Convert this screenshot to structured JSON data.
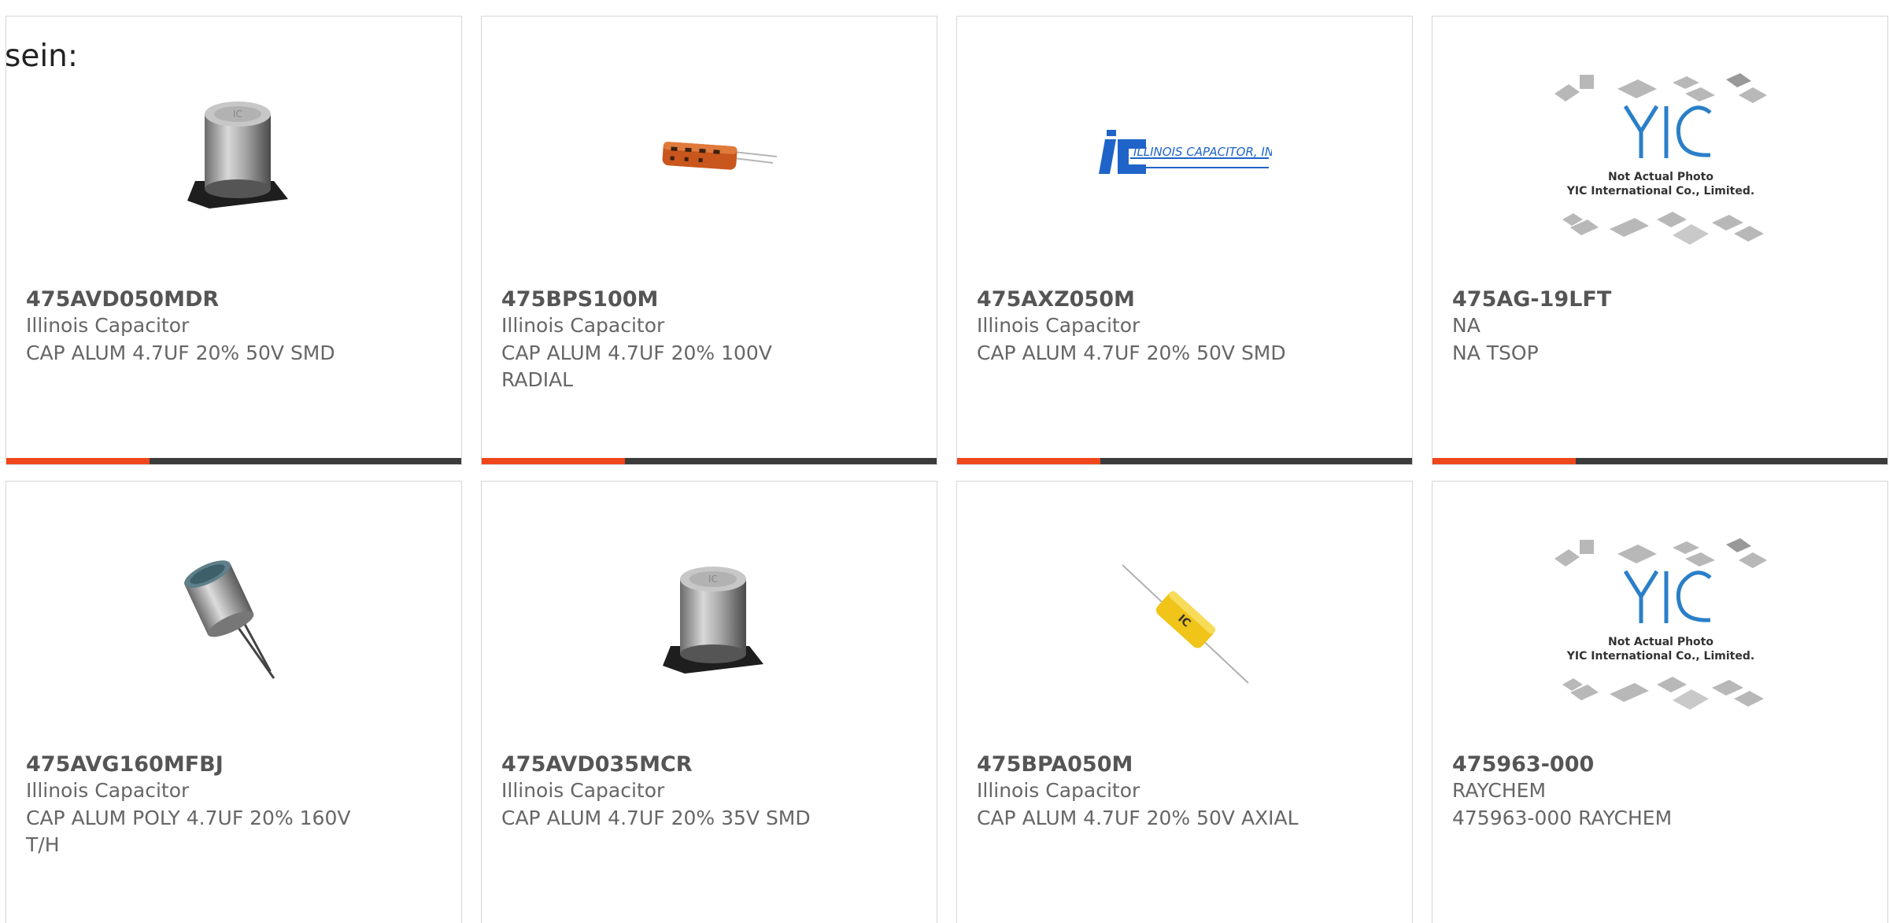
{
  "intro_text": "sein:",
  "colors": {
    "accent": "#f0461c",
    "bar_dark": "#3b3b3b",
    "border": "#d6d6d6"
  },
  "products": [
    {
      "part_number": "475AVD050MDR",
      "manufacturer": "Illinois Capacitor",
      "description": "CAP ALUM 4.7UF 20% 50V SMD",
      "image_icon": "smd-electrolytic-capacitor-icon"
    },
    {
      "part_number": "475BPS100M",
      "manufacturer": "Illinois Capacitor",
      "description": "CAP ALUM 4.7UF 20% 100V RADIAL",
      "image_icon": "radial-capacitor-icon"
    },
    {
      "part_number": "475AXZ050M",
      "manufacturer": "Illinois Capacitor",
      "description": "CAP ALUM 4.7UF 20% 50V SMD",
      "image_icon": "illinois-capacitor-logo",
      "logo_text": "ILLINOIS CAPACITOR, INC."
    },
    {
      "part_number": "475AG-19LFT",
      "manufacturer": "NA",
      "description": "NA TSOP",
      "image_icon": "yic-placeholder-image",
      "placeholder_line1": "Not Actual Photo",
      "placeholder_line2": "YIC International Co., Limited."
    },
    {
      "part_number": "475AVG160MFBJ",
      "manufacturer": "Illinois Capacitor",
      "description": "CAP ALUM POLY 4.7UF 20% 160V T/H",
      "image_icon": "through-hole-polymer-capacitor-icon"
    },
    {
      "part_number": "475AVD035MCR",
      "manufacturer": "Illinois Capacitor",
      "description": "CAP ALUM 4.7UF 20% 35V SMD",
      "image_icon": "smd-electrolytic-capacitor-icon"
    },
    {
      "part_number": "475BPA050M",
      "manufacturer": "Illinois Capacitor",
      "description": "CAP ALUM 4.7UF 20% 50V AXIAL",
      "image_icon": "axial-capacitor-icon"
    },
    {
      "part_number": "475963-000",
      "manufacturer": "RAYCHEM",
      "description": "475963-000 RAYCHEM",
      "image_icon": "yic-placeholder-image",
      "placeholder_line1": "Not Actual Photo",
      "placeholder_line2": "YIC International Co., Limited."
    }
  ]
}
